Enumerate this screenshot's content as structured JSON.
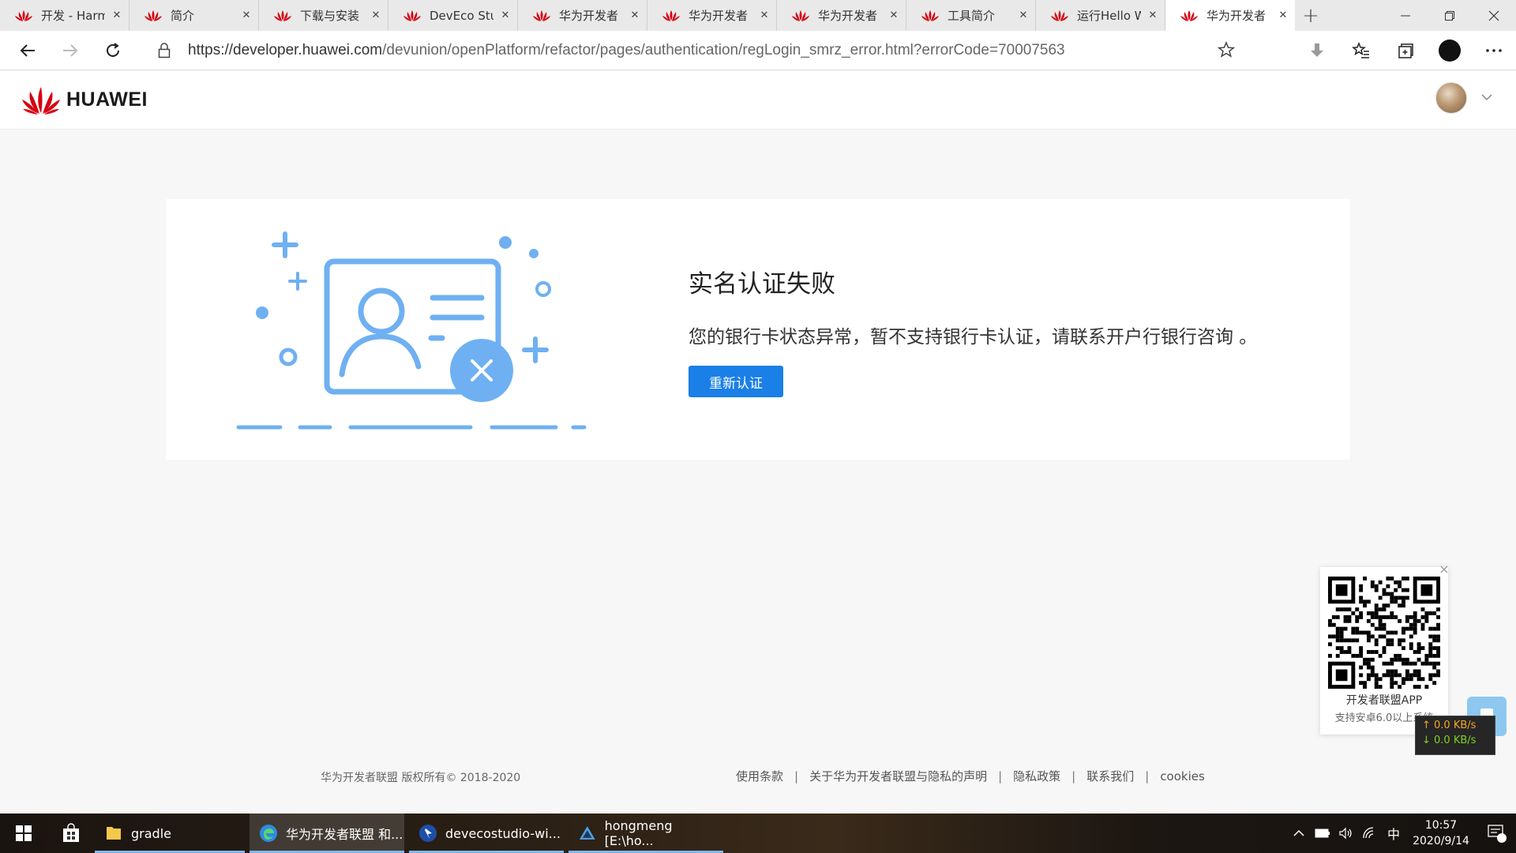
{
  "browser": {
    "tabs": [
      {
        "title": "开发 - Harm"
      },
      {
        "title": "简介"
      },
      {
        "title": "下载与安装"
      },
      {
        "title": "DevEco Stuc"
      },
      {
        "title": "华为开发者"
      },
      {
        "title": "华为开发者"
      },
      {
        "title": "华为开发者"
      },
      {
        "title": "工具简介"
      },
      {
        "title": "运行Hello W"
      },
      {
        "title": "华为开发者"
      }
    ],
    "active_tab_index": 9,
    "new_tab_label": "+",
    "url_host": "https://developer.huawei.com",
    "url_path": "/devunion/openPlatform/refactor/pages/authentication/regLogin_smrz_error.html?errorCode=70007563"
  },
  "site": {
    "logo_text": "HUAWEI"
  },
  "error": {
    "title": "实名认证失败",
    "message": "您的银行卡状态异常，暂不支持银行卡认证，请联系开户行银行咨询 。",
    "retry_label": "重新认证"
  },
  "footer": {
    "copyright": "华为开发者联盟 版权所有© 2018-2020",
    "links": [
      "使用条款",
      "关于华为开发者联盟与隐私的声明",
      "隐私政策",
      "联系我们",
      "cookies"
    ]
  },
  "qr_widget": {
    "line1": "开发者联盟APP",
    "line2": "支持安卓6.0以上系统",
    "close": "×"
  },
  "net_speed": {
    "up": "↑ 0.0 KB/s",
    "down": "↓ 0.0 KB/s"
  },
  "taskbar": {
    "tasks": [
      {
        "label": "gradle"
      },
      {
        "label": "华为开发者联盟 和..."
      },
      {
        "label": "devecostudio-wi..."
      },
      {
        "label": "hongmeng [E:\\ho..."
      }
    ],
    "ime": "中",
    "time": "10:57",
    "date": "2020/9/14",
    "notif_count": "1"
  },
  "colors": {
    "accent": "#1a7fe6",
    "illustration": "#6fb0f2",
    "huawei_red": "#d7000f"
  }
}
